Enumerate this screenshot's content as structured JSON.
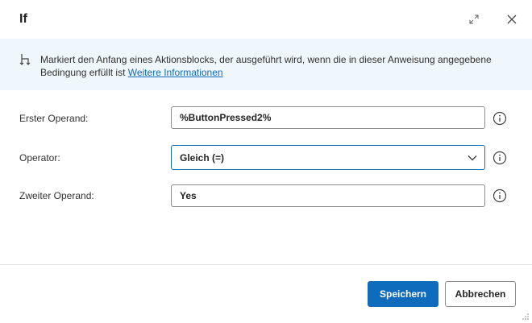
{
  "dialog": {
    "title": "If"
  },
  "info": {
    "text": "Markiert den Anfang eines Aktionsblocks, der ausgeführt wird, wenn die in dieser Anweisung angegebene Bedingung erfüllt ist ",
    "link": "Weitere Informationen"
  },
  "fields": {
    "first_operand": {
      "label": "Erster Operand:",
      "value": "%ButtonPressed2%"
    },
    "operator": {
      "label": "Operator:",
      "value": "Gleich (=)"
    },
    "second_operand": {
      "label": "Zweiter Operand:",
      "value": "Yes"
    }
  },
  "buttons": {
    "save": "Speichern",
    "cancel": "Abbrechen"
  },
  "icons": {
    "expand": "expand-icon",
    "close": "close-icon",
    "info": "flow-branch-icon",
    "help": "info-circle-icon",
    "chevron": "chevron-down-icon",
    "resize": "resize-grip-icon"
  },
  "colors": {
    "accent": "#0f6cbd",
    "info_background": "#eff6fc"
  }
}
